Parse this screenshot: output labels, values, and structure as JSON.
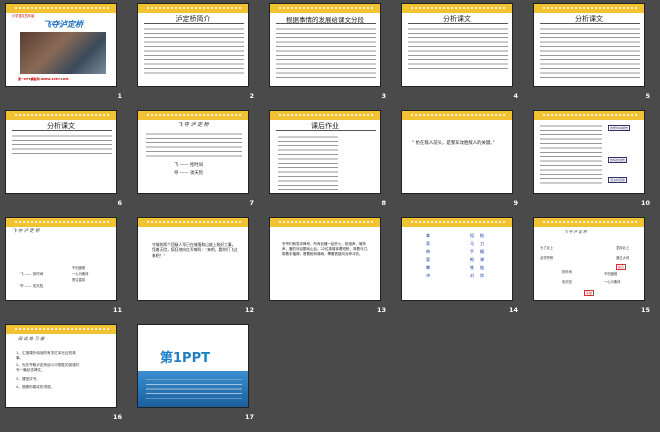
{
  "app": {
    "view": "slide-sorter"
  },
  "slides": [
    {
      "num": "1",
      "title": "飞夺泸定桥",
      "subtitle": "小学语文四年级",
      "footer": "第一PPT模板网-WWW.1PPT.COM"
    },
    {
      "num": "2",
      "title": "泸定桥简介"
    },
    {
      "num": "3",
      "title": "根据事情的发展给课文分段"
    },
    {
      "num": "4",
      "title": "分析课文"
    },
    {
      "num": "5",
      "title": "分析课文"
    },
    {
      "num": "6",
      "title": "分析课文"
    },
    {
      "num": "7",
      "title": "飞 夺 泸 定 桥",
      "lines": [
        "飞 —— 抢时间",
        "夺 —— 攻天险"
      ]
    },
    {
      "num": "8",
      "title": "课后作业"
    },
    {
      "num": "9",
      "quote": "“ 抢在敌人前头，是我军攻胜敌人的关键。”"
    },
    {
      "num": "10",
      "tags": [
        "向党中央报告",
        "热情的鼓舞",
        "坚决的回答"
      ]
    },
    {
      "num": "11",
      "title": "飞 夺 泸 定 桥",
      "lines": [
        "飞 —— 抢时间",
        "夺 —— 攻天险"
      ],
      "notes": [
        "不怕困难",
        "一心为集体",
        "勇往直前"
      ]
    },
    {
      "num": "12",
      "text": "守城的两个团敌人早已在城墙和山坡上筑好工事。凭着天险，疯狂地向红军喊叫：“来吧，看你们飞过来吧！”"
    },
    {
      "num": "13",
      "text": "冬爷们和党冲锋号，所有武器一起开火，枪炮声、喊杀声、震的河谷颤动山谷。22位英雄拿着短枪，背着马刀，带着手榴弹，冒着枪林弹雨，攀着铁链向对岸冲去。",
      "highlights": [
        "拿着",
        "背着",
        "带着"
      ]
    },
    {
      "num": "14",
      "col1": [
        "拿",
        "背",
        "带",
        "冒",
        "攀",
        "冲"
      ],
      "col2": [
        "短",
        "马",
        "手",
        "枪",
        "铁",
        "对"
      ],
      "col3": [
        "枪",
        "刀",
        "榴",
        "弹",
        "链",
        "岸"
      ]
    },
    {
      "num": "15",
      "title": "飞 夺 泸 定 桥",
      "labels": [
        "为了北上",
        "必须夺桥",
        "抢时间",
        "攻天险",
        "坚持北上",
        "渡过大河",
        "提高",
        "不怕困难",
        "英雄",
        "一心为集体"
      ]
    },
    {
      "num": "16",
      "title": "阅 读 练 习 册",
      "items": [
        "1、汇报课外阅读的有关红军长征的故事。",
        "2、为在夺取泸定桥战斗中牺牲的英雄们写一篇纪念碑文。",
        "3、课堂评书。",
        "4、观察你喜欢的词语。"
      ]
    },
    {
      "num": "17",
      "logo": "第1PPT"
    }
  ]
}
